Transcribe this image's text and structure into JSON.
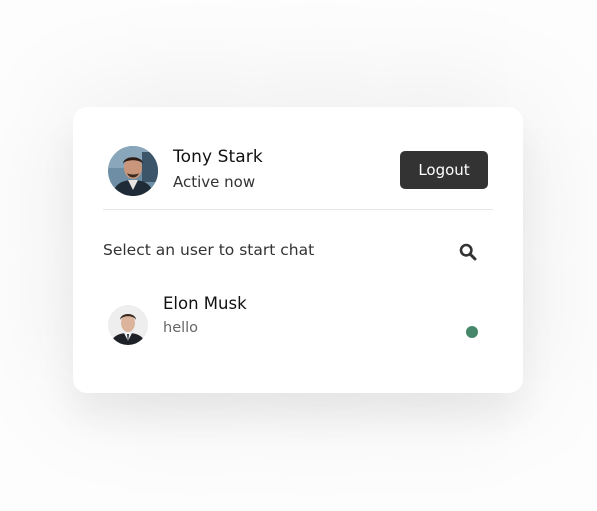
{
  "current_user": {
    "name": "Tony Stark",
    "status": "Active now"
  },
  "header": {
    "logout_label": "Logout"
  },
  "search": {
    "prompt": "Select an user to start chat",
    "icon": "search-icon"
  },
  "users": [
    {
      "name": "Elon Musk",
      "last_message": "hello",
      "online_color": "#468669"
    }
  ],
  "colors": {
    "button_bg": "#333333",
    "online": "#468669"
  }
}
